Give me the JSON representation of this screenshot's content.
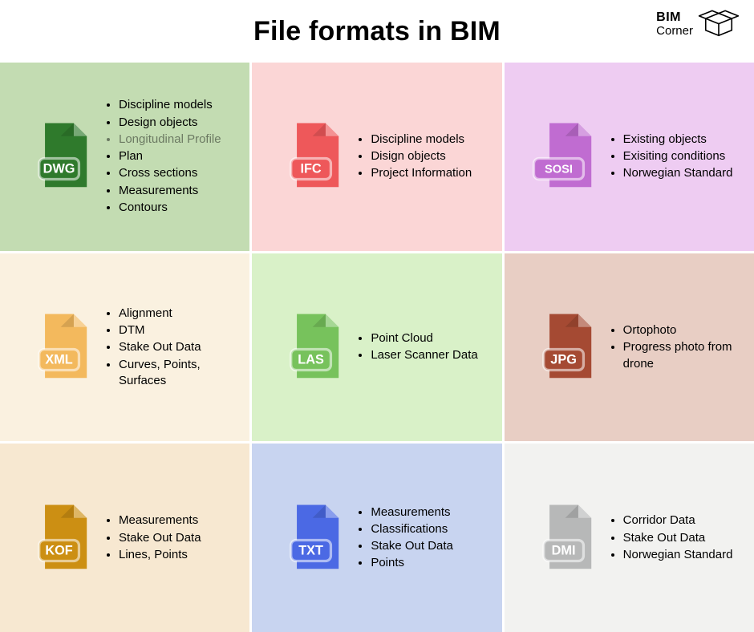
{
  "title": "File formats in BIM",
  "brand": {
    "line1": "BIM",
    "line2": "Corner"
  },
  "cards": [
    {
      "ext": "DWG",
      "bg": "#c3dcb2",
      "iconColor": "#2f7a2c",
      "items": [
        "Discipline models",
        "Design objects",
        "Longitudinal Profile",
        "Plan",
        "Cross sections",
        "Measurements",
        "Contours"
      ],
      "faded": [
        2
      ]
    },
    {
      "ext": "IFC",
      "bg": "#fbd6d6",
      "iconColor": "#ee585a",
      "items": [
        "Discipline models",
        "Disign objects",
        "Project Information"
      ]
    },
    {
      "ext": "SOSI",
      "bg": "#eeccf2",
      "iconColor": "#c06cd1",
      "items": [
        "Existing objects",
        "Exisiting conditions",
        "Norwegian Standard"
      ]
    },
    {
      "ext": "XML",
      "bg": "#faf1e0",
      "iconColor": "#f3b95d",
      "items": [
        "Alignment",
        "DTM",
        "Stake Out Data",
        "Curves, Points, Surfaces"
      ]
    },
    {
      "ext": "LAS",
      "bg": "#d9f1c8",
      "iconColor": "#77c25c",
      "items": [
        "Point Cloud",
        "Laser Scanner Data"
      ]
    },
    {
      "ext": "JPG",
      "bg": "#e8cec4",
      "iconColor": "#a54a33",
      "items": [
        "Ortophoto",
        "Progress photo from drone"
      ]
    },
    {
      "ext": "KOF",
      "bg": "#f7e8d1",
      "iconColor": "#cc8f13",
      "items": [
        "Measurements",
        "Stake Out Data",
        "Lines, Points"
      ]
    },
    {
      "ext": "TXT",
      "bg": "#c8d4f0",
      "iconColor": "#4b69e4",
      "items": [
        "Measurements",
        "Classifications",
        "Stake Out Data",
        "Points"
      ]
    },
    {
      "ext": "DMI",
      "bg": "#f2f2f0",
      "iconColor": "#b7b8b8",
      "items": [
        "Corridor Data",
        "Stake Out Data",
        "Norwegian Standard"
      ]
    }
  ]
}
